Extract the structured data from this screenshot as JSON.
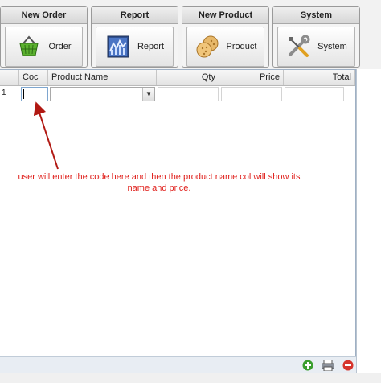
{
  "toolbar": {
    "groups": [
      {
        "title": "New Order",
        "button_label": "Order",
        "icon": "shopping-basket-icon"
      },
      {
        "title": "Report",
        "button_label": "Report",
        "icon": "chart-report-icon"
      },
      {
        "title": "New Product",
        "button_label": "Product",
        "icon": "cookies-product-icon"
      },
      {
        "title": "System",
        "button_label": "System",
        "icon": "tools-wrench-icon"
      }
    ]
  },
  "grid": {
    "columns": [
      {
        "label": "Coc"
      },
      {
        "label": "Product Name"
      },
      {
        "label": "Qty"
      },
      {
        "label": "Price"
      },
      {
        "label": "Total"
      }
    ],
    "rows": [
      {
        "row_number": "1",
        "code": "",
        "product_name": "",
        "qty": "",
        "price": "",
        "total": ""
      }
    ]
  },
  "annotation": {
    "text": "user will enter the code here and then the product name col will show its name and price.",
    "color": "#e0201c"
  },
  "footer": {
    "icons": [
      "add-icon",
      "print-icon",
      "delete-icon"
    ]
  },
  "colors": {
    "accent_border": "#7ea6cf",
    "add": "#3a9e2e",
    "delete": "#d6342c"
  }
}
